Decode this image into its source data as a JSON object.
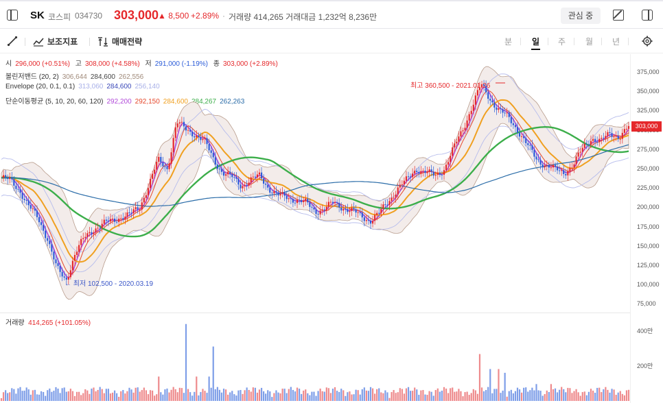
{
  "header": {
    "stock_name": "SK",
    "market": "코스피",
    "code": "034730",
    "price": "303,000",
    "change": "▲ 8,500",
    "change_pct": "+2.89%",
    "separator": "·",
    "volume_info": "거래량 414,265  거래대금 1,232억 8,236만",
    "interest_button": "관심 중",
    "accent_color": "#e5282b"
  },
  "toolbar": {
    "draw_label": "",
    "indicator_label": "보조지표",
    "strategy_label": "매매전략",
    "periods": [
      "분",
      "일",
      "주",
      "월",
      "년"
    ],
    "active_period": "일"
  },
  "legend": {
    "ohlc": {
      "open_label": "시",
      "open_value": "296,000 (+0.51%)",
      "high_label": "고",
      "high_value": "308,000 (+4.58%)",
      "low_label": "저",
      "low_value": "291,000 (-1.19%)",
      "close_label": "종",
      "close_value": "303,000 (+2.89%)"
    },
    "bollinger": {
      "label": "볼린저밴드 (20, 2)",
      "values": [
        "306,644",
        "284,600",
        "262,556"
      ],
      "colors": [
        "#a08a7a",
        "#444444",
        "#a08a7a"
      ]
    },
    "envelope": {
      "label": "Envelope (20, 0.1, 0.1)",
      "values": [
        "313,060",
        "284,600",
        "256,140"
      ],
      "colors": [
        "#a8b0e8",
        "#3a48b8",
        "#a8b0e8"
      ]
    },
    "ma": {
      "label": "단순이동평균 (5, 10, 20, 60, 120)",
      "values": [
        "292,200",
        "292,150",
        "284,600",
        "284,267",
        "262,263"
      ],
      "colors": [
        "#b04ad8",
        "#e5482b",
        "#f0a020",
        "#3cae4a",
        "#2a6ca8"
      ]
    }
  },
  "annotations": {
    "high": "최고 360,500 - 2021.01.26",
    "low": "← 최저 102,500 - 2020.03.19"
  },
  "price_axis": {
    "ticks": [
      "375,000",
      "350,000",
      "325,000",
      "300,000",
      "275,000",
      "250,000",
      "225,000",
      "200,000",
      "175,000",
      "150,000",
      "125,000",
      "100,000",
      "75,000"
    ],
    "current_price_tag": "303,000"
  },
  "volume": {
    "title": "거래량",
    "value": "414,265 (+101.05%)",
    "ticks": [
      "400만",
      "200만"
    ]
  },
  "chart_data": {
    "type": "candlestick",
    "y_range": [
      75000,
      375000
    ],
    "series": [
      {
        "name": "close",
        "values": [
          238000,
          234000,
          222000,
          200000,
          185000,
          160000,
          120000,
          105000,
          140000,
          160000,
          172000,
          178000,
          182000,
          188000,
          190000,
          200000,
          230000,
          260000,
          250000,
          310000,
          300000,
          295000,
          285000,
          262000,
          245000,
          238000,
          228000,
          235000,
          240000,
          225000,
          215000,
          212000,
          210000,
          205000,
          195000,
          198000,
          205000,
          200000,
          195000,
          188000,
          183000,
          192000,
          208000,
          225000,
          235000,
          250000,
          245000,
          240000,
          250000,
          275000,
          300000,
          330000,
          358000,
          340000,
          325000,
          315000,
          300000,
          280000,
          262000,
          255000,
          248000,
          245000,
          255000,
          275000,
          290000,
          285000,
          295000,
          292000,
          303000
        ]
      }
    ]
  }
}
